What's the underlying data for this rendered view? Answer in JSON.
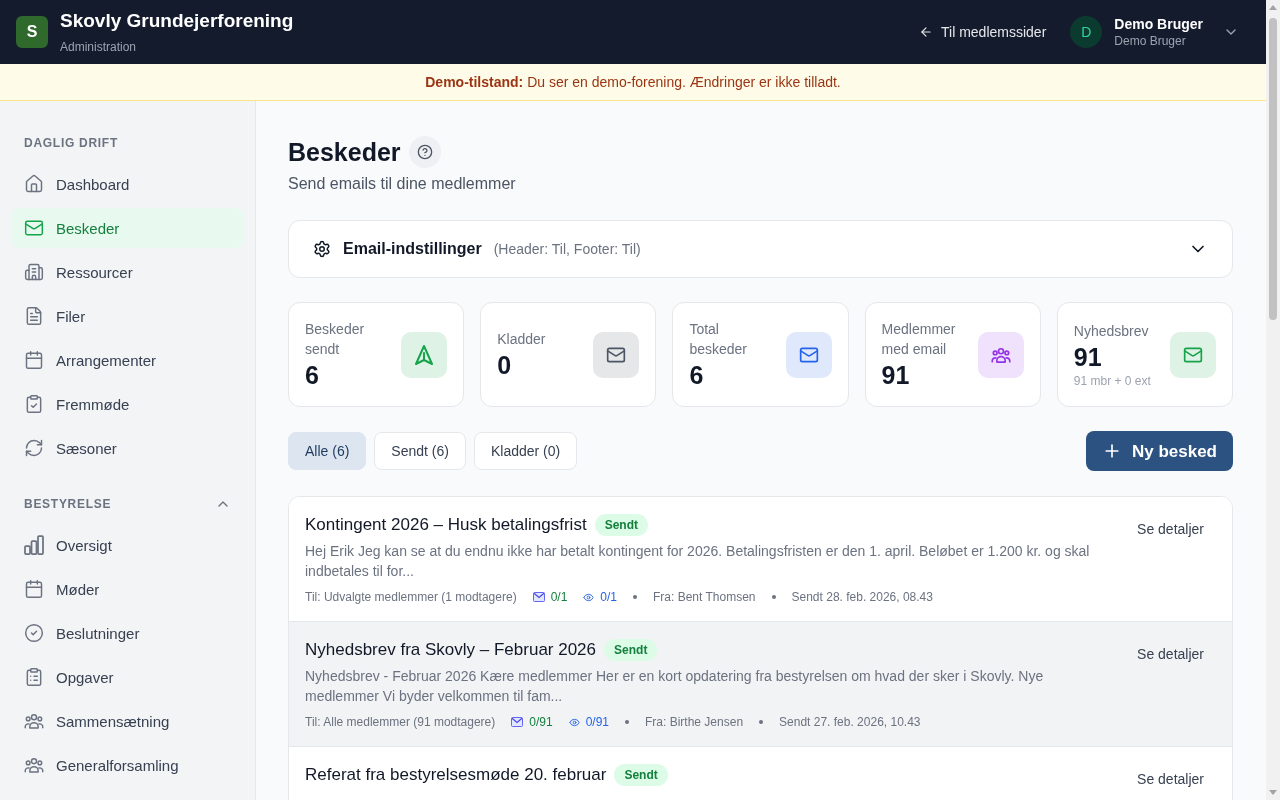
{
  "header": {
    "logo_letter": "S",
    "title": "Skovly Grundejerforening",
    "subtitle": "Administration",
    "back_link": "Til medlemssider",
    "user": {
      "initial": "D",
      "name": "Demo Bruger",
      "role": "Demo Bruger"
    }
  },
  "banner": "**Demo-tilstand:** Du ser en demo-forening. Ændringer er ikke tilladt.",
  "sidebar": {
    "sections": [
      {
        "title": "DAGLIG DRIFT",
        "items": [
          {
            "label": "Dashboard",
            "selected": false
          },
          {
            "label": "Beskeder",
            "selected": true
          },
          {
            "label": "Ressourcer",
            "selected": false
          },
          {
            "label": "Filer",
            "selected": false
          },
          {
            "label": "Arrangementer",
            "selected": false
          },
          {
            "label": "Fremmøde",
            "selected": false
          },
          {
            "label": "Sæsoner",
            "selected": false
          }
        ]
      },
      {
        "title": "BESTYRELSE",
        "expanded": true,
        "items": [
          {
            "label": "Oversigt",
            "selected": false
          },
          {
            "label": "Møder",
            "selected": false
          },
          {
            "label": "Beslutninger",
            "selected": false
          },
          {
            "label": "Opgaver",
            "selected": false
          },
          {
            "label": "Sammensætning",
            "selected": false
          },
          {
            "label": "Generalforsamling",
            "selected": false
          }
        ]
      }
    ]
  },
  "page": {
    "title": "Beskeder",
    "subtitle": "Send emails til dine medlemmer"
  },
  "email_settings": {
    "title": "Email-indstillinger",
    "summary": "(Header: Til, Footer: Til)",
    "expanded": false
  },
  "stats": [
    {
      "label": "Beskeder sendt",
      "value": "6",
      "color": "#16a34a"
    },
    {
      "label": "Kladder",
      "value": "0",
      "color": "#4b5563"
    },
    {
      "label": "Total beskeder",
      "value": "6",
      "color": "#2563eb"
    },
    {
      "label": "Medlemmer med email",
      "value": "91",
      "color": "#9333ea"
    },
    {
      "label": "Nyhedsbrev",
      "value": "91",
      "note": "91 mbr + 0 ext",
      "color": "#16a34a"
    }
  ],
  "filters": [
    {
      "label": "Alle (6)",
      "selected": true
    },
    {
      "label": "Sendt (6)",
      "selected": false
    },
    {
      "label": "Kladder (0)",
      "selected": false
    }
  ],
  "new_button": "Ny besked",
  "messages": [
    {
      "title": "Kontingent 2026 – Husk betalingsfrist",
      "badge": "Sendt",
      "preview": "Hej Erik Jeg kan se at du endnu ikke har betalt kontingent for 2026. Betalingsfristen er den 1. april. Beløbet er 1.200 kr. og skal indbetales til for...",
      "recipients": "Til: Udvalgte medlemmer (1 modtagere)",
      "mail_stat": "0/1",
      "view_stat": "0/1",
      "sender": "Fra: Bent Thomsen",
      "sent": "Sendt 28. feb. 2026, 08.43",
      "action": "Se detaljer",
      "highlighted": false
    },
    {
      "title": "Nyhedsbrev fra Skovly – Februar 2026",
      "badge": "Sendt",
      "preview": "Nyhedsbrev - Februar 2026 Kære medlemmer Her er en kort opdatering fra bestyrelsen om hvad der sker i Skovly. Nye medlemmer Vi byder velkommen til fam...",
      "recipients": "Til: Alle medlemmer (91 modtagere)",
      "mail_stat": "0/91",
      "view_stat": "0/91",
      "sender": "Fra: Birthe Jensen",
      "sent": "Sendt 27. feb. 2026, 10.43",
      "action": "Se detaljer",
      "highlighted": true
    },
    {
      "title": "Referat fra bestyrelsesmøde 20. februar",
      "badge": "Sendt",
      "action": "Se detaljer",
      "highlighted": false
    }
  ]
}
